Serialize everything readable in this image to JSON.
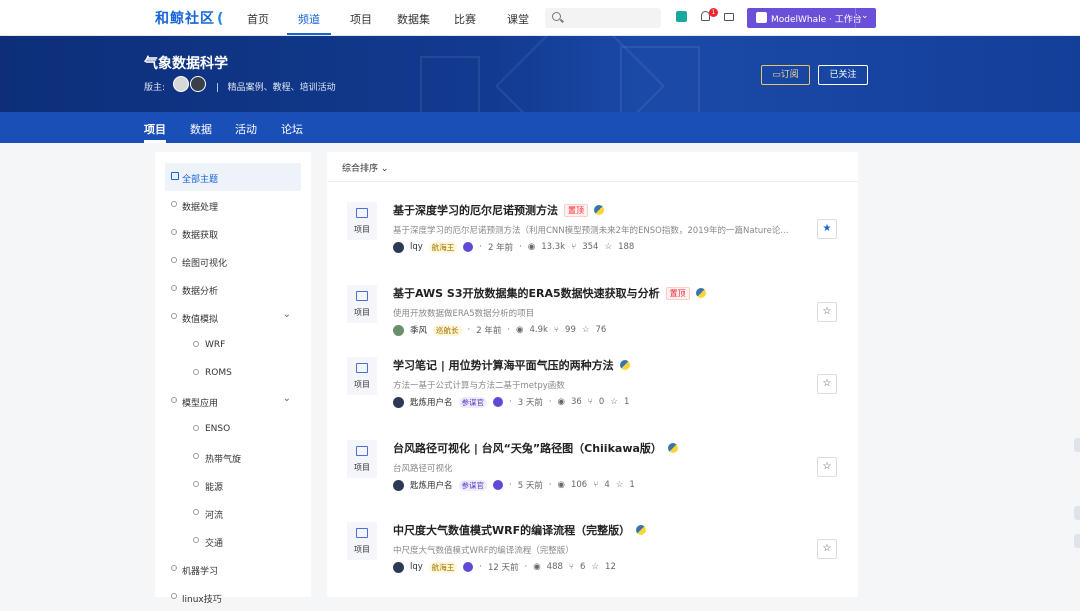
{
  "topnav": {
    "logo": "和鲸社区",
    "items": [
      {
        "label": "首页"
      },
      {
        "label": "频道",
        "active": true
      },
      {
        "label": "项目"
      },
      {
        "label": "数据集"
      },
      {
        "label": "比赛"
      },
      {
        "label": "课堂"
      }
    ],
    "search_placeholder": "",
    "notification_count": "1",
    "workbench_label": "ModelWhale · 工作台"
  },
  "banner": {
    "title": "气象数据科学",
    "moderator_label": "版主:",
    "separator": "|",
    "description": "精品案例、教程、培训活动",
    "subscribe_label": "订阅",
    "follow_label": "已关注"
  },
  "subtabs": [
    {
      "label": "项目",
      "active": true
    },
    {
      "label": "数据"
    },
    {
      "label": "活动"
    },
    {
      "label": "论坛"
    }
  ],
  "sidebar": {
    "items": [
      {
        "label": "全部主题",
        "active": true
      },
      {
        "label": "数据处理"
      },
      {
        "label": "数据获取"
      },
      {
        "label": "绘图可视化"
      },
      {
        "label": "数据分析"
      },
      {
        "label": "数值模拟",
        "expandable": true
      },
      {
        "label": "WRF",
        "sub": true
      },
      {
        "label": "ROMS",
        "sub": true
      },
      {
        "label": "模型应用",
        "expandable": true
      },
      {
        "label": "ENSO",
        "sub": true
      },
      {
        "label": "热带气旋",
        "sub": true
      },
      {
        "label": "能源",
        "sub": true
      },
      {
        "label": "河流",
        "sub": true
      },
      {
        "label": "交通",
        "sub": true
      },
      {
        "label": "机器学习"
      },
      {
        "label": "linux技巧"
      }
    ]
  },
  "main": {
    "sort_label": "综合排序",
    "type_label": "项目",
    "items": [
      {
        "title": "基于深度学习的厄尔尼诺预测方法",
        "pinned": "置顶",
        "desc": "基于深度学习的厄尔尼诺预测方法（利用CNN模型预测未来2年的ENSO指数，2019年的一篇Nature论...",
        "user": "lqy",
        "rank": "航海王",
        "time": "2 年前",
        "views": "13.3k",
        "forks": "354",
        "stars": "188",
        "starred": true
      },
      {
        "title": "基于AWS S3开放数据集的ERA5数据快速获取与分析",
        "pinned": "置顶",
        "desc": "使用开放数据做ERA5数据分析的项目",
        "user": "季风",
        "rank": "巡航长",
        "time": "2 年前",
        "views": "4.9k",
        "forks": "99",
        "stars": "76",
        "starred": false
      },
      {
        "title": "学习笔记 | 用位势计算海平面气压的两种方法",
        "pinned": "",
        "desc": "方法一基于公式计算与方法二基于metpy函数",
        "user": "匙炼用户名",
        "rank": "参谋官",
        "time": "3 天前",
        "views": "36",
        "forks": "0",
        "stars": "1",
        "starred": false
      },
      {
        "title": "台风路径可视化 | 台风“天兔”路径图（Chiikawa版）",
        "pinned": "",
        "desc": "台风路径可视化",
        "user": "匙炼用户名",
        "rank": "参谋官",
        "time": "5 天前",
        "views": "106",
        "forks": "4",
        "stars": "1",
        "starred": false
      },
      {
        "title": "中尺度大气数值模式WRF的编译流程（完整版）",
        "pinned": "",
        "desc": "中尺度大气数值模式WRF的编译流程（完整版）",
        "user": "lqy",
        "rank": "航海王",
        "time": "12 天前",
        "views": "488",
        "forks": "6",
        "stars": "12",
        "starred": false
      }
    ]
  },
  "colors": {
    "brand": "#1565d8",
    "workbench": "#6b4fd8",
    "banner": "#123a8f",
    "subtabs": "#1b4fb8"
  }
}
